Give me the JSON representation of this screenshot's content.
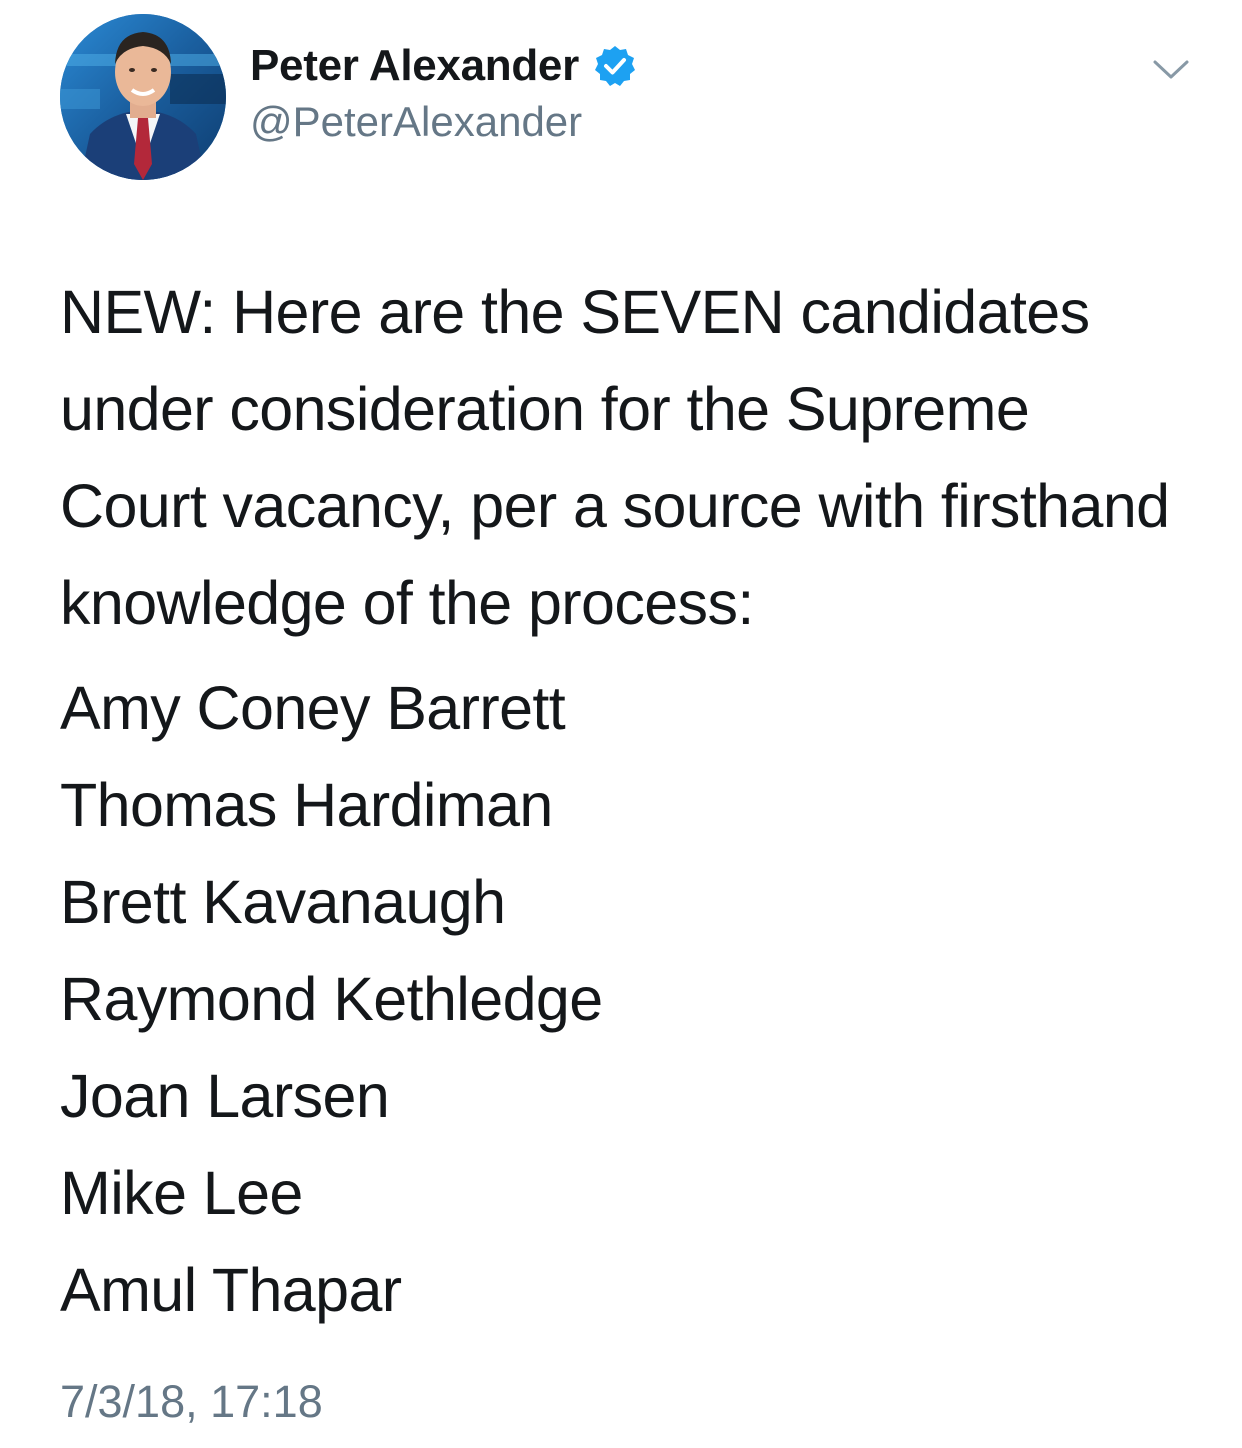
{
  "author": {
    "display_name": "Peter Alexander",
    "handle": "@PeterAlexander",
    "verified": true,
    "verified_badge_icon": "verified-badge-icon",
    "avatar_icon": "profile-photo"
  },
  "menu": {
    "icon": "chevron-down-icon"
  },
  "tweet": {
    "intro": "NEW: Here are the SEVEN candidates under consideration for the Supreme Court vacancy, per a source with firsthand knowledge of the process:",
    "candidates": [
      "Amy Coney Barrett",
      "Thomas Hardiman",
      "Brett Kavanaugh",
      "Raymond Kethledge",
      "Joan Larsen",
      "Mike Lee",
      "Amul Thapar"
    ],
    "timestamp": "7/3/18, 17:18"
  },
  "colors": {
    "text_primary": "#14171a",
    "text_secondary": "#657786",
    "verified_blue": "#1da1f2",
    "chevron": "#8899a6",
    "background": "#ffffff"
  }
}
